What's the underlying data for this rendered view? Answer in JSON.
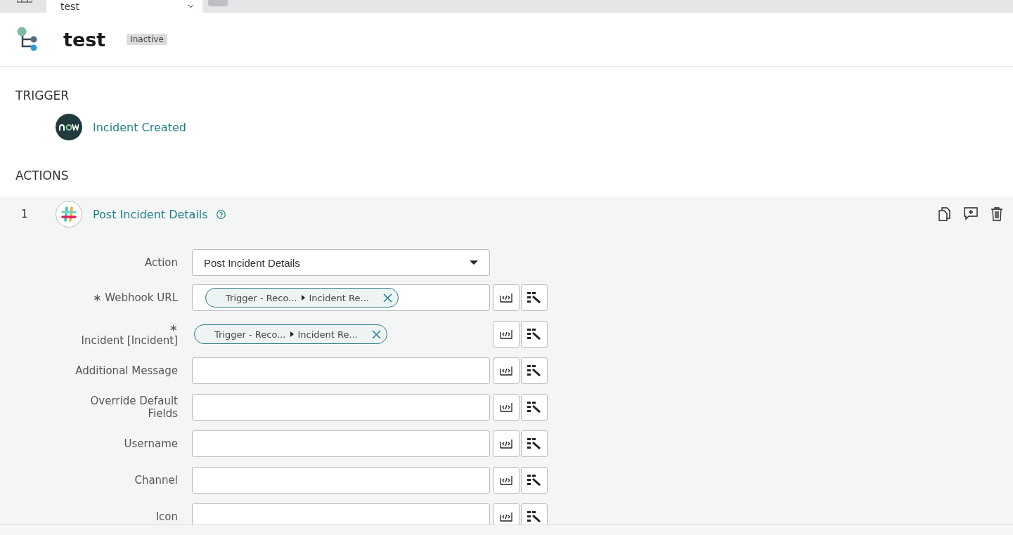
{
  "tabs": [
    {
      "label": "test",
      "selected": true
    }
  ],
  "header": {
    "title": "test",
    "status": "Inactive"
  },
  "trigger": {
    "heading": "TRIGGER",
    "name": "Incident Created"
  },
  "actions": {
    "heading": "ACTIONS",
    "items": [
      {
        "number": "1",
        "name": "Post Incident Details",
        "fields": [
          {
            "kind": "select",
            "label": "Action",
            "required": false,
            "value": "Post Incident Details"
          },
          {
            "kind": "pill",
            "label": "Webhook URL",
            "required": true,
            "mark": "∗",
            "boxed": true,
            "pill": [
              "Trigger - Reco...",
              "Incident Re..."
            ]
          },
          {
            "kind": "pill",
            "label": "Incident [Incident]",
            "required": true,
            "mark": "∗",
            "boxed": false,
            "pill": [
              "Trigger - Reco...",
              "Incident Re..."
            ]
          },
          {
            "kind": "text",
            "label": "Additional Message",
            "required": false
          },
          {
            "kind": "text",
            "label": "Override Default Fields",
            "required": false
          },
          {
            "kind": "text",
            "label": "Username",
            "required": false
          },
          {
            "kind": "text",
            "label": "Channel",
            "required": false
          },
          {
            "kind": "text",
            "label": "Icon",
            "required": false
          }
        ]
      }
    ]
  }
}
